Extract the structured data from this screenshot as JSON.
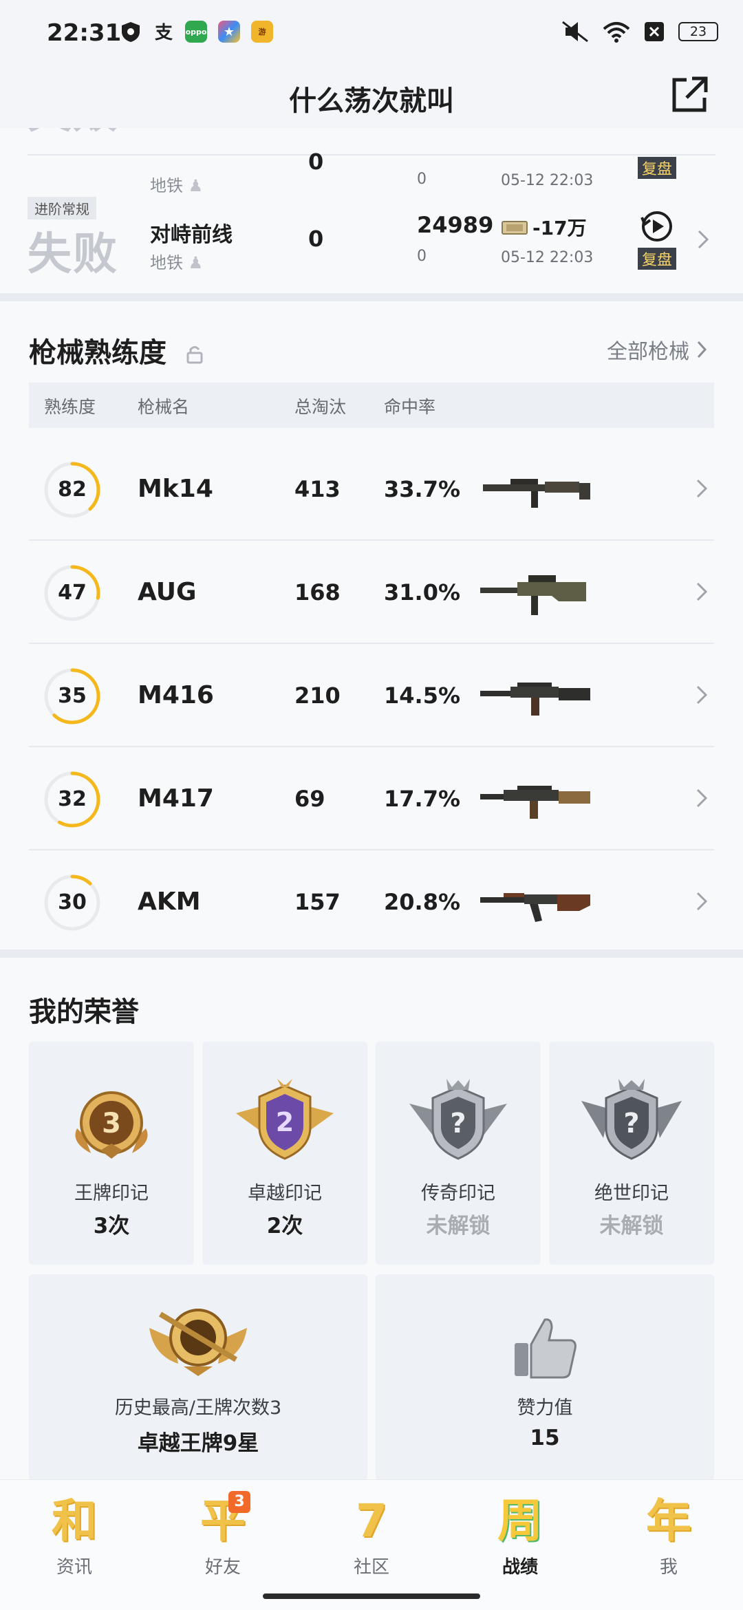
{
  "status_bar": {
    "time": "22:31",
    "battery": "23",
    "left_icons": [
      "shield-icon",
      "alipay-icon",
      "oppo-icon",
      "app-icon",
      "game-center-icon"
    ],
    "right_icons": [
      "mute-icon",
      "wifi-icon",
      "close-box-icon",
      "battery-icon"
    ]
  },
  "header": {
    "title": "什么荡次就叫",
    "share_icon": "share-icon"
  },
  "matches": [
    {
      "result": "失败",
      "mode": "",
      "map": "",
      "map_type": "地铁",
      "kills": "0",
      "score": "",
      "score_sub": "0",
      "money": "",
      "date": "05-12 22:03",
      "replay_label": "复盘"
    },
    {
      "result": "失败",
      "mode": "进阶常规",
      "map": "对峙前线",
      "map_type": "地铁",
      "kills": "0",
      "score": "24989",
      "score_sub": "0",
      "money": "-17万",
      "date": "05-12 22:03",
      "replay_label": "复盘"
    }
  ],
  "weapon_section": {
    "title": "枪械熟练度",
    "all_link": "全部枪械",
    "columns": [
      "熟练度",
      "枪械名",
      "总淘汰",
      "命中率"
    ],
    "weapons": [
      {
        "proficiency": "82",
        "progress": 0.38,
        "name": "Mk14",
        "kills": "413",
        "accuracy": "33.7%"
      },
      {
        "proficiency": "47",
        "progress": 0.28,
        "name": "AUG",
        "kills": "168",
        "accuracy": "31.0%"
      },
      {
        "proficiency": "35",
        "progress": 0.62,
        "name": "M416",
        "kills": "210",
        "accuracy": "14.5%"
      },
      {
        "proficiency": "32",
        "progress": 0.58,
        "name": "M417",
        "kills": "69",
        "accuracy": "17.7%"
      },
      {
        "proficiency": "30",
        "progress": 0.12,
        "name": "AKM",
        "kills": "157",
        "accuracy": "20.8%"
      }
    ]
  },
  "honor_section": {
    "title": "我的荣誉",
    "badges": [
      {
        "label": "王牌印记",
        "value": "3次",
        "badge_text": "3",
        "locked": false
      },
      {
        "label": "卓越印记",
        "value": "2次",
        "badge_text": "2",
        "locked": false
      },
      {
        "label": "传奇印记",
        "value": "未解锁",
        "badge_text": "?",
        "locked": true
      },
      {
        "label": "绝世印记",
        "value": "未解锁",
        "badge_text": "?",
        "locked": true
      }
    ],
    "history": {
      "label": "历史最高/王牌次数3",
      "value": "卓越王牌9星"
    },
    "likes": {
      "label": "赞力值",
      "value": "15"
    }
  },
  "bottom_nav": [
    {
      "glyph": "和",
      "label": "资讯",
      "badge": ""
    },
    {
      "glyph": "平",
      "label": "好友",
      "badge": "3"
    },
    {
      "glyph": "7",
      "label": "社区",
      "badge": ""
    },
    {
      "glyph": "周",
      "label": "战绩",
      "badge": "",
      "active": true
    },
    {
      "glyph": "年",
      "label": "我",
      "badge": ""
    }
  ],
  "colors": {
    "accent_yellow": "#f5b81c",
    "ring_track": "#e8eaee",
    "replay_bg": "#3c4048"
  }
}
